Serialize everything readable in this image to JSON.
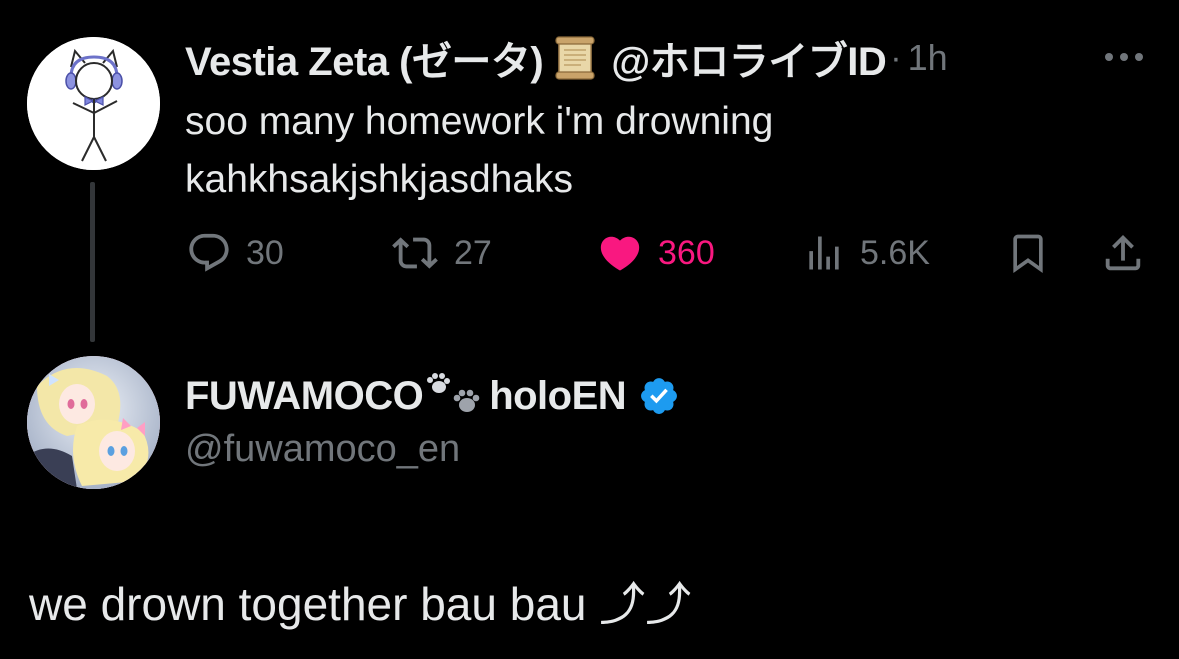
{
  "parent_tweet": {
    "display_name": "Vestia Zeta (ゼータ)",
    "handle": "@ホロライブID",
    "separator": "·",
    "time": "1h",
    "text_line1": "soo many homework i'm drowning",
    "text_line2": "kahkhsakjshkjasdhaks",
    "avatar_icon": "stick-figure-cat-avatar",
    "emoji_icon": "scroll-emoji",
    "actions": {
      "reply_count": "30",
      "retweet_count": "27",
      "like_count": "360",
      "view_count": "5.6K"
    },
    "colors": {
      "like": "#f91880",
      "muted": "#71767b",
      "text": "#e7e9ea"
    }
  },
  "reply_tweet": {
    "display_name_part1": "FUWAMOCO",
    "display_name_part2": "holoEN",
    "paw_icon": "paw-prints-emoji",
    "verified_icon": "verified-badge-icon",
    "verified_color": "#1d9bf0",
    "handle": "@fuwamoco_en",
    "text": "we drown together bau bau ⤴︎⤴︎"
  },
  "background": "#000000"
}
